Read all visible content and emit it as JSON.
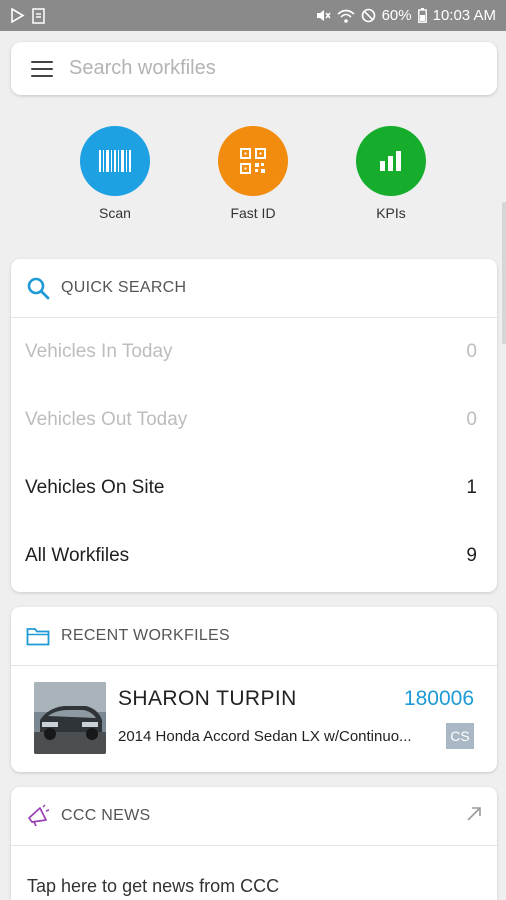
{
  "status_bar": {
    "battery": "60%",
    "time": "10:03 AM"
  },
  "search": {
    "placeholder": "Search workfiles"
  },
  "shortcuts": [
    {
      "label": "Scan",
      "color": "#1da1e2",
      "icon": "barcode-icon"
    },
    {
      "label": "Fast ID",
      "color": "#f28c0f",
      "icon": "qr-code-icon"
    },
    {
      "label": "KPIs",
      "color": "#16ad2d",
      "icon": "bar-chart-icon"
    }
  ],
  "quick_search": {
    "title": "QUICK SEARCH",
    "rows": [
      {
        "label": "Vehicles In Today",
        "count": "0"
      },
      {
        "label": "Vehicles Out Today",
        "count": "0"
      },
      {
        "label": "Vehicles On Site",
        "count": "1"
      },
      {
        "label": "All Workfiles",
        "count": "9"
      }
    ]
  },
  "recent_workfiles": {
    "title": "RECENT WORKFILES",
    "items": [
      {
        "name": "SHARON TURPIN",
        "number": "180006",
        "description": "2014 Honda Accord Sedan LX w/Continuo...",
        "badge": "CS"
      }
    ]
  },
  "news": {
    "title": "CCC NEWS",
    "body": "Tap here to get news from CCC"
  },
  "colors": {
    "accent": "#1e9ad6",
    "news_icon": "#9b3fb5"
  }
}
